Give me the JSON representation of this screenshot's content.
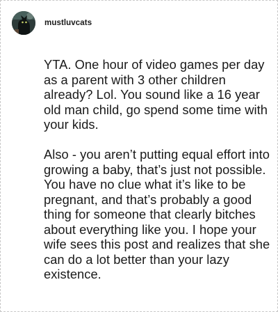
{
  "post": {
    "username": "mustluvcats",
    "avatar": {
      "icon": "cat-avatar-icon",
      "background": "#2d3b3a"
    },
    "paragraphs": [
      "YTA. One hour of video games per day as a parent with 3 other children already? Lol. You sound like a 16 year old man child, go spend some time with your kids.",
      "Also - you aren’t putting equal effort into growing a baby, that’s just not possible. You have no clue what it’s like to be pregnant, and that’s probably a good thing for someone that clearly bitches about everything like you. I hope your wife sees this post and realizes that she can do a lot better than your lazy existence."
    ]
  },
  "colors": {
    "text": "#1a1a1a",
    "border": "#c8c8c8",
    "background": "#ffffff"
  }
}
